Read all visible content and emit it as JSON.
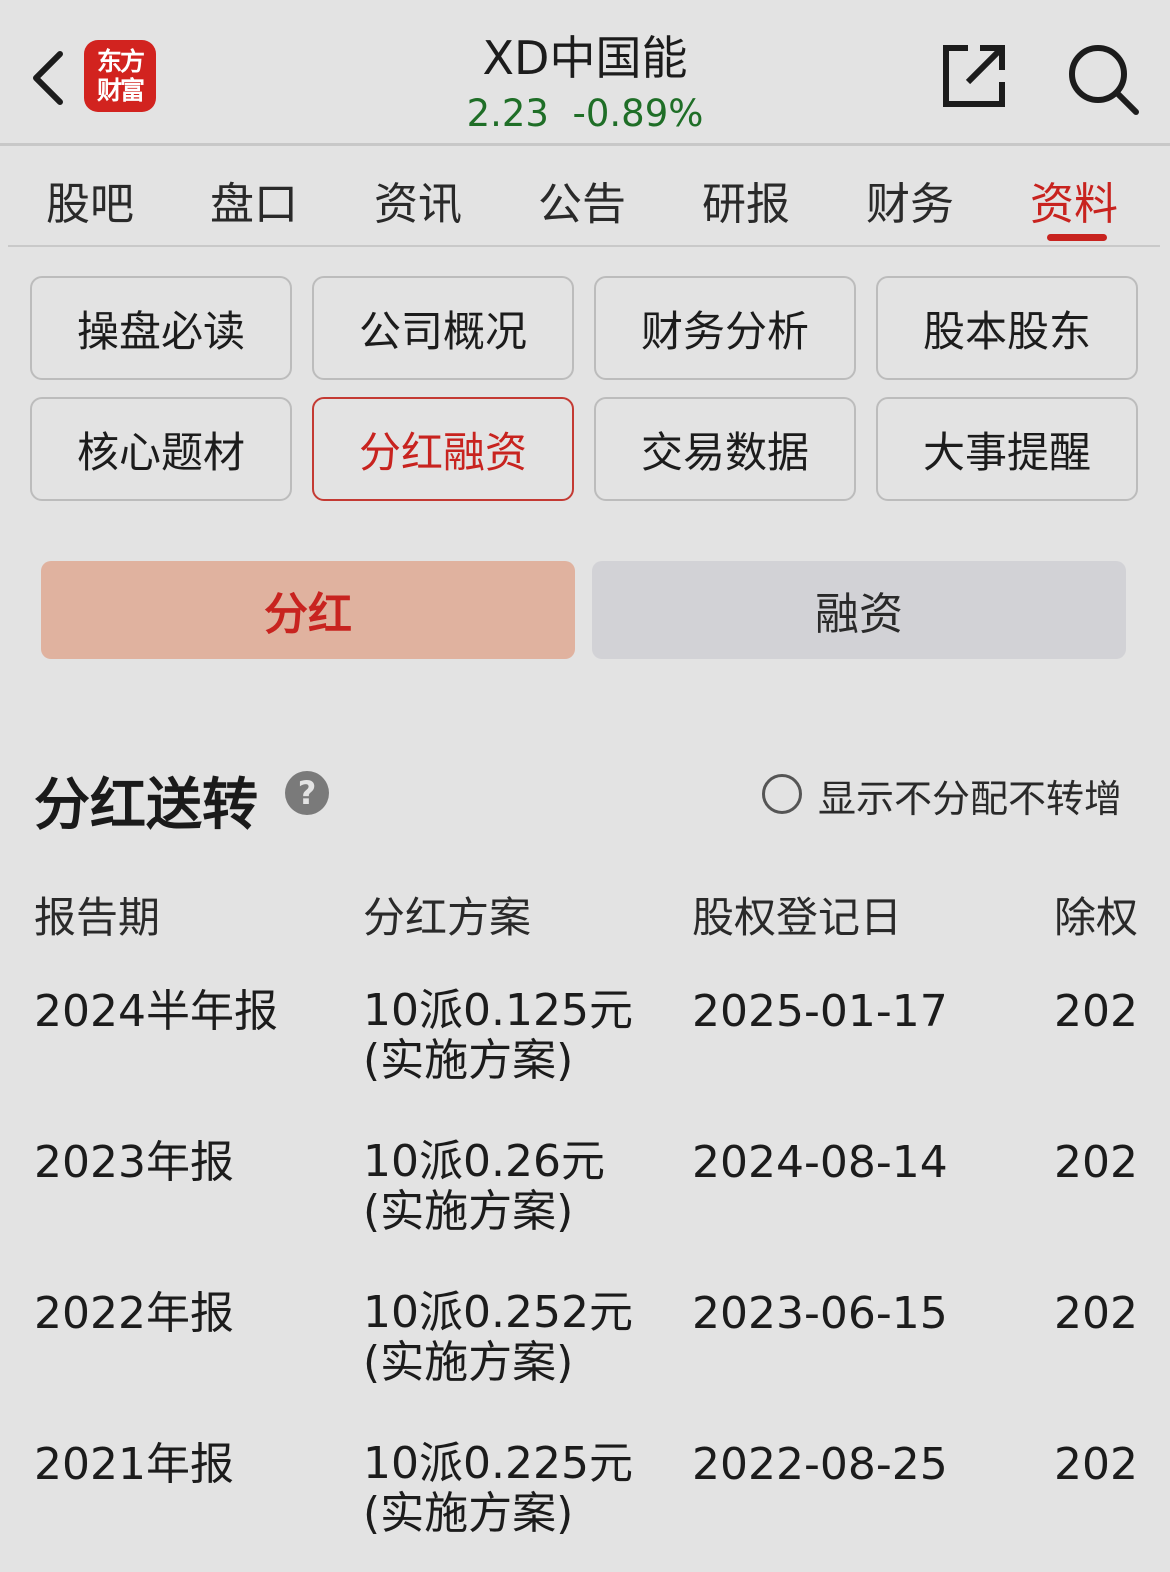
{
  "header": {
    "logo_line1": "东方",
    "logo_line2": "财富",
    "stock_name": "XD中国能",
    "price": "2.23",
    "change": "-0.89%"
  },
  "tabs": [
    {
      "label": "股吧"
    },
    {
      "label": "盘口"
    },
    {
      "label": "资讯"
    },
    {
      "label": "公告"
    },
    {
      "label": "研报"
    },
    {
      "label": "财务"
    },
    {
      "label": "资料",
      "active": true
    }
  ],
  "categories": [
    {
      "label": "操盘必读"
    },
    {
      "label": "公司概况"
    },
    {
      "label": "财务分析"
    },
    {
      "label": "股本股东"
    },
    {
      "label": "核心题材"
    },
    {
      "label": "分红融资",
      "active": true
    },
    {
      "label": "交易数据"
    },
    {
      "label": "大事提醒"
    }
  ],
  "segment": {
    "dividend": "分红",
    "financing": "融资",
    "selected": "dividend"
  },
  "section": {
    "title": "分红送转",
    "help": "?",
    "toggle_label": "显示不分配不转增",
    "toggle_checked": false
  },
  "table": {
    "headers": [
      "报告期",
      "分红方案",
      "股权登记日",
      "除权"
    ],
    "rows": [
      {
        "period": "2024半年报",
        "plan": "10派0.125元",
        "plan_status": "(实施方案)",
        "record_date": "2025-01-17",
        "ex_date": "202"
      },
      {
        "period": "2023年报",
        "plan": "10派0.26元",
        "plan_status": "(实施方案)",
        "record_date": "2024-08-14",
        "ex_date": "202"
      },
      {
        "period": "2022年报",
        "plan": "10派0.252元",
        "plan_status": "(实施方案)",
        "record_date": "2023-06-15",
        "ex_date": "202"
      },
      {
        "period": "2021年报",
        "plan": "10派0.225元",
        "plan_status": "(实施方案)",
        "record_date": "2022-08-25",
        "ex_date": "202"
      }
    ]
  },
  "colors": {
    "accent": "#c8231f",
    "price_green": "#1f6e27",
    "background": "#e3e3e3"
  }
}
